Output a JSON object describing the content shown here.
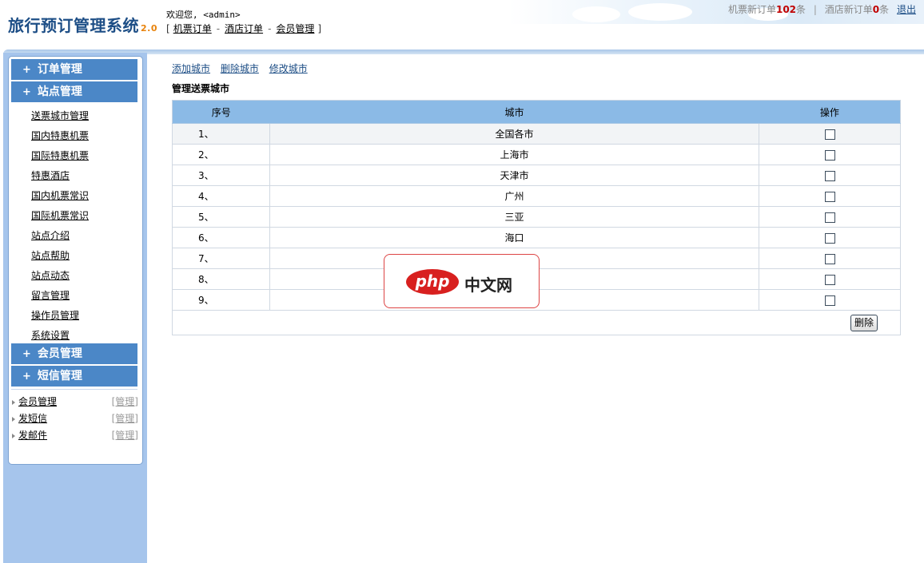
{
  "header": {
    "title": "旅行预订管理系统",
    "version": "2.0",
    "welcome": "欢迎您, <admin>",
    "nav": [
      "机票订单",
      "酒店订单",
      "会员管理"
    ],
    "flight_orders_prefix": "机票新订单",
    "flight_orders_count": "102",
    "flight_orders_suffix": "条",
    "hotel_orders_prefix": "酒店新订单",
    "hotel_orders_count": "0",
    "hotel_orders_suffix": "条",
    "logout": "退出"
  },
  "sidebar": {
    "menus": [
      "订单管理",
      "站点管理",
      "会员管理",
      "短信管理"
    ],
    "items": [
      "送票城市管理",
      "国内特惠机票",
      "国际特惠机票",
      "特惠酒店",
      "国内机票常识",
      "国际机票常识",
      "站点介绍",
      "站点帮助",
      "站点动态",
      "留言管理",
      "操作员管理",
      "系统设置"
    ],
    "manage": [
      {
        "label": "会员管理",
        "action": "[管理]"
      },
      {
        "label": "发短信",
        "action": "[管理]"
      },
      {
        "label": "发邮件",
        "action": "[管理]"
      }
    ]
  },
  "content": {
    "links": [
      "添加城市",
      "删除城市",
      "修改城市"
    ],
    "title": "管理送票城市",
    "columns": [
      "序号",
      "城市",
      "操作"
    ],
    "rows": [
      {
        "no": "1、",
        "city": "全国各市"
      },
      {
        "no": "2、",
        "city": "上海市"
      },
      {
        "no": "3、",
        "city": "天津市"
      },
      {
        "no": "4、",
        "city": "广州"
      },
      {
        "no": "5、",
        "city": "三亚"
      },
      {
        "no": "6、",
        "city": "海口"
      },
      {
        "no": "7、",
        "city": ""
      },
      {
        "no": "8、",
        "city": ""
      },
      {
        "no": "9、",
        "city": ""
      }
    ],
    "delete_button": "删除"
  },
  "watermark": {
    "logo": "php",
    "text": "中文网"
  },
  "colors": {
    "accent": "#4b87c7",
    "sidebar_bg": "#a6c5ec",
    "table_header": "#8bbae6",
    "count_red": "#c00000"
  }
}
